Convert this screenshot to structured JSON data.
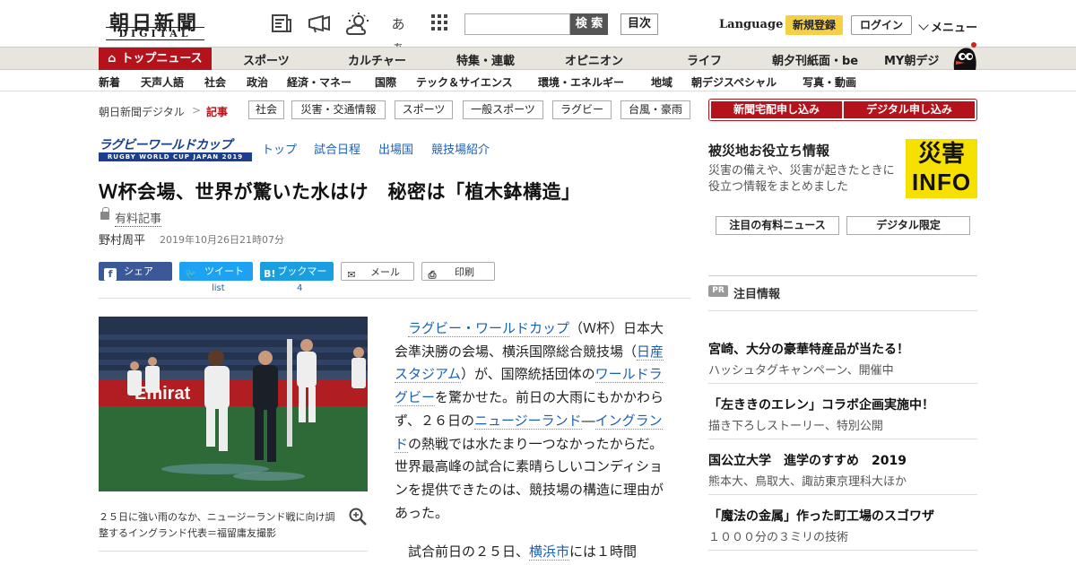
{
  "header": {
    "logo_main": "朝日新聞",
    "logo_sub": "DIGITAL",
    "icons": [
      "newspaper-icon",
      "megaphone-icon",
      "weather-icon",
      "font-size-icon",
      "grid-icon"
    ],
    "font_size_label": "あぁ",
    "search_placeholder": "",
    "search_button": "検 索",
    "toc_button": "目次",
    "language": "Language",
    "register": "新規登録",
    "login": "ログイン",
    "menu": "メニュー"
  },
  "nav": {
    "top_news": "トップニュース",
    "items": [
      "スポーツ",
      "カルチャー",
      "特集・連載",
      "オピニオン",
      "ライフ",
      "朝夕刊紙面・be",
      "MY朝デジ"
    ],
    "subitems": [
      "新着",
      "天声人語",
      "社会",
      "政治",
      "経済・マネー",
      "国際",
      "テック＆サイエンス",
      "環境・エネルギー",
      "地域",
      "朝デジスペシャル",
      "写真・動画"
    ]
  },
  "breadcrumb": {
    "home": "朝日新聞デジタル",
    "separator": ">",
    "current": "記事",
    "tags": [
      "社会",
      "災害・交通情報",
      "スポーツ",
      "一般スポーツ",
      "ラグビー",
      "台風・豪雨"
    ]
  },
  "rwc": {
    "logo_top": "ラグビーワールドカップ",
    "logo_bottom": "RUGBY WORLD CUP JAPAN 2019",
    "links": [
      "トップ",
      "試合日程",
      "出場国",
      "競技場紹介"
    ]
  },
  "article": {
    "headline": "Ｗ杯会場、世界が驚いた水はけ　秘密は「植木鉢構造」",
    "paid_label": "有料記事",
    "author": "野村周平",
    "date": "2019年10月26日21時07分",
    "share": {
      "facebook": "シェア",
      "twitter": "ツイート",
      "hatena": "ブックマーク",
      "mail": "メール",
      "print": "印刷",
      "twitter_count": "list",
      "hatena_count": "4"
    },
    "caption": "２５日に強い雨のなか、ニュージーランド戦に向け調整するイングランド代表＝福留庸友撮影",
    "p1_parts": {
      "a": "ラグビー・ワールドカップ",
      "b": "（Ｗ杯）日本大会準決勝の会場、横浜国際総合競技場（",
      "c": "日産スタジアム",
      "d": "）が、国際統括団体の",
      "e": "ワールドラグビー",
      "f": "を驚かせた。前日の大雨にもかかわらず、２６日の",
      "g": "ニュージーランド",
      "h": "―",
      "i": "イングランド",
      "j": "の熱戦では水たまり一つなかったからだ。世界最高峰の試合に素晴らしいコンディションを提供できたのは、競技場の構造に理由があった。"
    },
    "p2_parts": {
      "a": "試合前日の２５日、",
      "b": "横浜市",
      "c": "には１時間"
    }
  },
  "sidebar": {
    "subscribe_paper": "新聞宅配申し込み",
    "subscribe_digital": "デジタル申し込み",
    "disaster_title": "被災地お役立ち情報",
    "disaster_desc": "災害の備えや、災害が起きたときに役立つ情報をまとめました",
    "disaster_logo_top": "災害",
    "disaster_logo_bottom": "INFO",
    "btn_paid_news": "注目の有料ニュース",
    "btn_digital_only": "デジタル限定",
    "pr_badge": "PR",
    "pr_title": "注目情報",
    "pr_items": [
      {
        "title": "宮崎、大分の豪華特産品が当たる！",
        "sub": "ハッシュタグキャンペーン、開催中"
      },
      {
        "title": "「左ききのエレン」コラボ企画実施中！",
        "sub": "描き下ろしストーリー、特別公開"
      },
      {
        "title": "国公立大学　進学のすすめ　2019",
        "sub": "熊本大、鳥取大、諏訪東京理科大ほか"
      },
      {
        "title": "「魔法の金属」作った町工場のスゴワザ",
        "sub": "１０００分の３ミリの技術"
      }
    ]
  },
  "colors": {
    "brand_red": "#b5131c",
    "link_blue": "#1a5fb4",
    "rwc_blue": "#1b3f8f",
    "register_yellow": "#f5d046",
    "disaster_yellow": "#f6e000"
  }
}
